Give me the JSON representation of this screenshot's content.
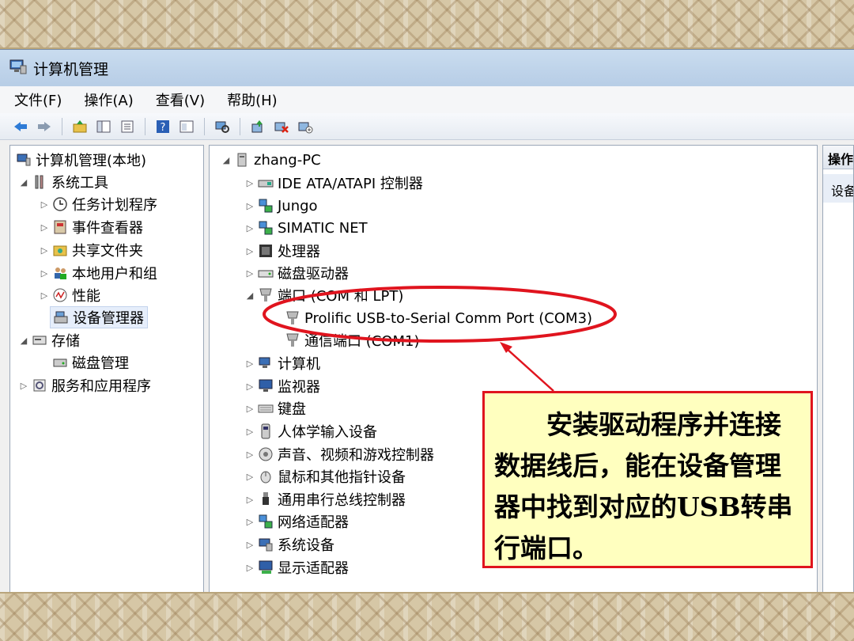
{
  "window": {
    "title": "计算机管理"
  },
  "menu": [
    "文件(F)",
    "操作(A)",
    "查看(V)",
    "帮助(H)"
  ],
  "toolbar": {
    "buttons": [
      "back-icon",
      "forward-icon",
      "up-folder-icon",
      "console-tree-icon",
      "export-list-icon",
      "help-icon",
      "properties-icon",
      "scan-hardware-icon",
      "update-driver-icon",
      "uninstall-icon",
      "disable-icon"
    ]
  },
  "left_tree": {
    "root": "计算机管理(本地)",
    "system_tools": "系统工具",
    "task_scheduler": "任务计划程序",
    "event_viewer": "事件查看器",
    "shared_folders": "共享文件夹",
    "local_users": "本地用户和组",
    "performance": "性能",
    "device_manager": "设备管理器",
    "storage": "存储",
    "disk_management": "磁盘管理",
    "services_apps": "服务和应用程序"
  },
  "device_tree": {
    "computer": "zhang-PC",
    "ide": "IDE ATA/ATAPI 控制器",
    "jungo": "Jungo",
    "simatic": "SIMATIC NET",
    "processor": "处理器",
    "disk_drives": "磁盘驱动器",
    "ports": "端口 (COM 和 LPT)",
    "port_prolific": "Prolific USB-to-Serial Comm Port (COM3)",
    "port_com1": "通信端口 (COM1)",
    "computer_cat": "计算机",
    "monitors": "监视器",
    "keyboards": "键盘",
    "hid": "人体学输入设备",
    "sound": "声音、视频和游戏控制器",
    "mice": "鼠标和其他指针设备",
    "usb": "通用串行总线控制器",
    "network": "网络适配器",
    "system_devices": "系统设备",
    "display": "显示适配器"
  },
  "actions_pane": {
    "header": "操作",
    "item": "设备管理器"
  },
  "annotation": {
    "text": "安装驱动程序并连接数据线后，能在设备管理器中找到对应的USB转串行端口。",
    "highlight_color": "#e0141e",
    "box_color": "#ffffbf"
  }
}
